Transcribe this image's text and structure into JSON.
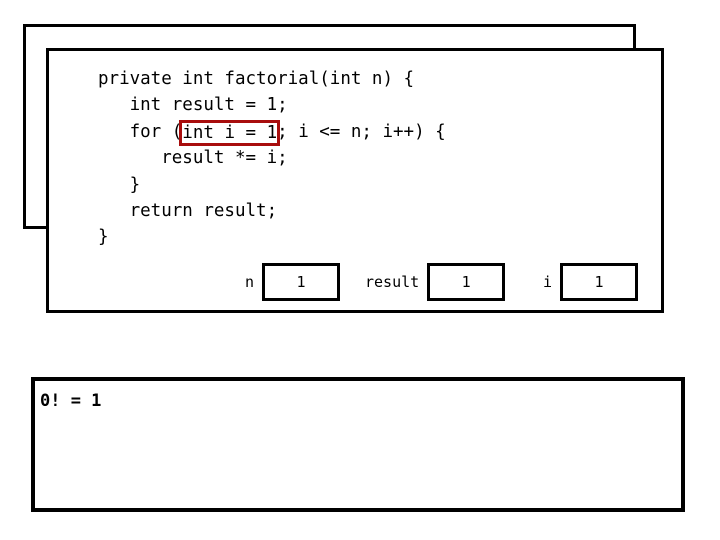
{
  "window": {
    "back_frame_label": "previous-call-frame",
    "front_frame_label": "current-call-frame"
  },
  "code": {
    "language": "java",
    "highlight_text": "int i = 1",
    "highlight_color": "#a80d0d",
    "lines": [
      {
        "pre": "private int factorial(int n) {",
        "highlight": "",
        "post": ""
      },
      {
        "pre": "   int result = 1;",
        "highlight": "",
        "post": ""
      },
      {
        "pre": "   for (",
        "highlight": "int i = 1",
        "post": "; i <= n; i++) {"
      },
      {
        "pre": "      result *= i;",
        "highlight": "",
        "post": ""
      },
      {
        "pre": "   }",
        "highlight": "",
        "post": ""
      },
      {
        "pre": "   return result;",
        "highlight": "",
        "post": ""
      },
      {
        "pre": "}",
        "highlight": "",
        "post": ""
      }
    ]
  },
  "variables": [
    {
      "name": "n",
      "value": "1"
    },
    {
      "name": "result",
      "value": "1"
    },
    {
      "name": "i",
      "value": "1"
    }
  ],
  "output": {
    "text": "0! = 1"
  },
  "colors": {
    "background": "#ffffff",
    "border": "#000000",
    "highlight": "#a80d0d"
  }
}
